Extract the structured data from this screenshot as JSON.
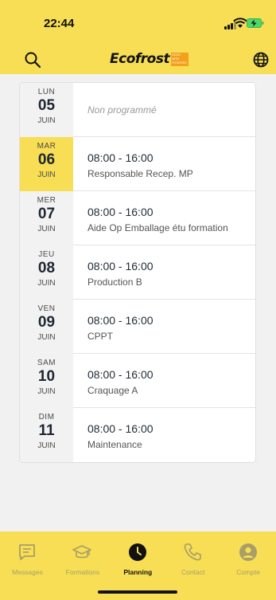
{
  "status_bar": {
    "time": "22:44"
  },
  "header": {
    "brand": "Ecofrost",
    "brand_tag": "GOOD WITH POTATOES"
  },
  "schedule": [
    {
      "dow": "LUN",
      "day": "05",
      "month": "JUIN",
      "hours": "",
      "post": "",
      "note": "Non programmé",
      "active": false
    },
    {
      "dow": "MAR",
      "day": "06",
      "month": "JUIN",
      "hours": "08:00 - 16:00",
      "post": "Responsable Recep. MP",
      "note": "",
      "active": true
    },
    {
      "dow": "MER",
      "day": "07",
      "month": "JUIN",
      "hours": "08:00 - 16:00",
      "post": "Aide Op Emballage étu formation",
      "note": "",
      "active": false
    },
    {
      "dow": "JEU",
      "day": "08",
      "month": "JUIN",
      "hours": "08:00 - 16:00",
      "post": "Production B",
      "note": "",
      "active": false
    },
    {
      "dow": "VEN",
      "day": "09",
      "month": "JUIN",
      "hours": "08:00 - 16:00",
      "post": "CPPT",
      "note": "",
      "active": false
    },
    {
      "dow": "SAM",
      "day": "10",
      "month": "JUIN",
      "hours": "08:00 - 16:00",
      "post": "Craquage A",
      "note": "",
      "active": false
    },
    {
      "dow": "DIM",
      "day": "11",
      "month": "JUIN",
      "hours": "08:00 - 16:00",
      "post": "Maintenance",
      "note": "",
      "active": false
    }
  ],
  "tabs": [
    {
      "label": "Messages",
      "icon": "chat-icon",
      "active": false
    },
    {
      "label": "Formations",
      "icon": "graduation-cap-icon",
      "active": false
    },
    {
      "label": "Planning",
      "icon": "clock-icon",
      "active": true
    },
    {
      "label": "Contact",
      "icon": "phone-icon",
      "active": false
    },
    {
      "label": "Compte",
      "icon": "user-icon",
      "active": false
    }
  ],
  "colors": {
    "accent": "#f7de55",
    "active_tab": "#111111",
    "inactive_tab": "#a89e68"
  }
}
